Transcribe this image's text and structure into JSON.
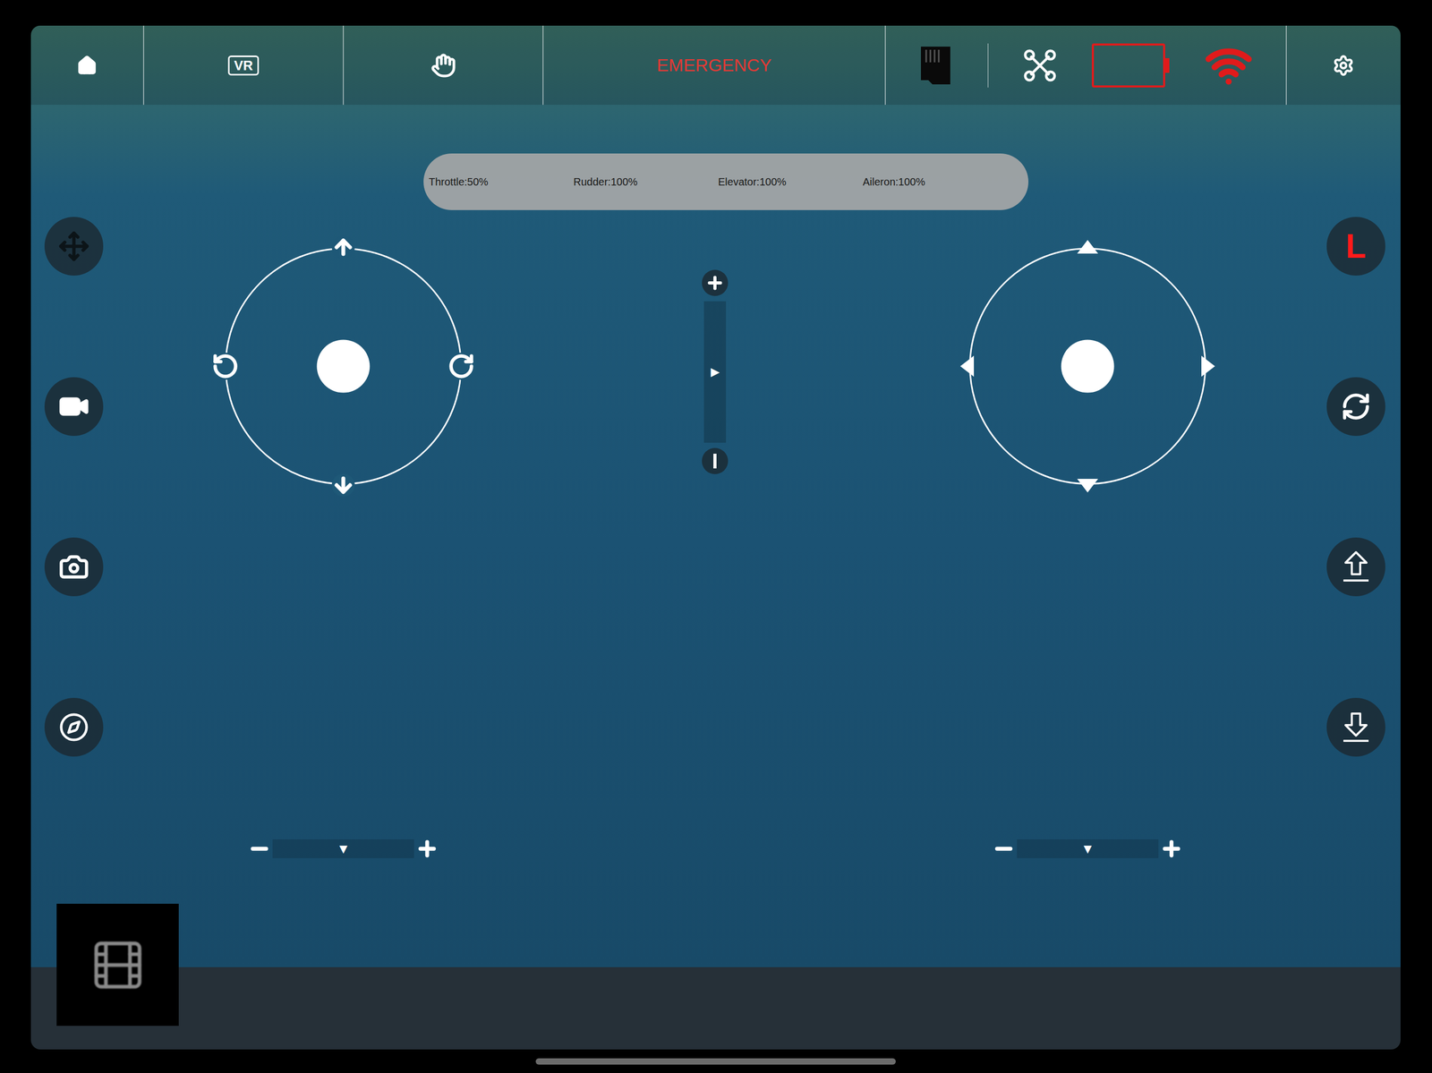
{
  "top_bar": {
    "vr_label": "VR",
    "emergency": "EMERGENCY",
    "battery": {
      "level": 0,
      "low": true
    },
    "wifi": {
      "connected": false
    }
  },
  "status": [
    {
      "label": "Throttle:50%"
    },
    {
      "label": "Rudder:100%"
    },
    {
      "label": "Elevator:100%"
    },
    {
      "label": "Aileron:100%"
    }
  ],
  "left_stick": {
    "x": 0,
    "y": 0
  },
  "right_stick": {
    "x": 0,
    "y": 0
  },
  "throttle_slider": {
    "marker": "▶",
    "level": 0.5
  },
  "trims": [
    {
      "marker": "▼",
      "level": 0.5
    },
    {
      "marker": "▼",
      "level": 0.5
    }
  ],
  "mode_button": {
    "label": "L"
  }
}
